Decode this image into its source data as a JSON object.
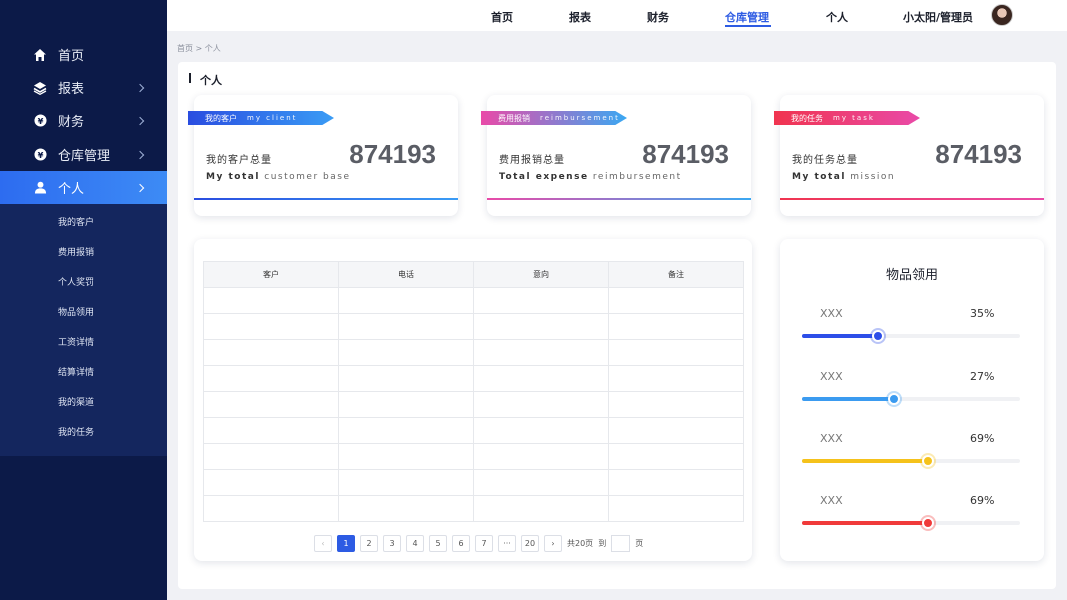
{
  "sidebar": {
    "items": [
      {
        "label": "首页",
        "icon": "home-icon"
      },
      {
        "label": "报表",
        "icon": "layers-icon"
      },
      {
        "label": "财务",
        "icon": "yen-icon"
      },
      {
        "label": "仓库管理",
        "icon": "yen-icon"
      },
      {
        "label": "个人",
        "icon": "user-icon"
      }
    ],
    "submenu": [
      "我的客户",
      "费用报销",
      "个人奖罚",
      "物品领用",
      "工资详情",
      "结算详情",
      "我的渠道",
      "我的任务"
    ]
  },
  "header": {
    "nav": [
      "首页",
      "报表",
      "财务",
      "仓库管理",
      "个人"
    ],
    "active_nav": "仓库管理",
    "user": "小太阳/管理员"
  },
  "breadcrumb": "首页 > 个人",
  "panel_title": "个人",
  "cards": [
    {
      "tag_zh": "我的客户",
      "tag_en": "my client",
      "label": "我的客户总量",
      "value": "874193",
      "sub_bold": "My total",
      "sub_rest": "customer base",
      "color": "#2d5be3"
    },
    {
      "tag_zh": "费用报销",
      "tag_en": "reimbursement",
      "label": "费用报销总量",
      "value": "874193",
      "sub_bold": "Total expense",
      "sub_rest": "reimbursement",
      "color": "#e84a9e"
    },
    {
      "tag_zh": "我的任务",
      "tag_en": "my task",
      "label": "我的任务总量",
      "value": "874193",
      "sub_bold": "My total",
      "sub_rest": "mission",
      "color": "#f0345a"
    }
  ],
  "table": {
    "headers": [
      "客户",
      "电话",
      "意向",
      "备注"
    ]
  },
  "pager": {
    "prev": "‹",
    "next": "›",
    "pages": [
      "1",
      "2",
      "3",
      "4",
      "5",
      "6",
      "7",
      "···",
      "20"
    ],
    "current": "1",
    "total": "共20页",
    "goto": "到",
    "unit": "页"
  },
  "usage": {
    "title": "物品领用",
    "items": [
      {
        "name": "XXX",
        "pct": "35%",
        "value": 0.35,
        "color": "#2d4ee8"
      },
      {
        "name": "XXX",
        "pct": "27%",
        "value": 0.42,
        "color": "#3b9bf0"
      },
      {
        "name": "XXX",
        "pct": "69%",
        "value": 0.58,
        "color": "#f5c21b"
      },
      {
        "name": "XXX",
        "pct": "69%",
        "value": 0.58,
        "color": "#f03a3a"
      }
    ]
  }
}
